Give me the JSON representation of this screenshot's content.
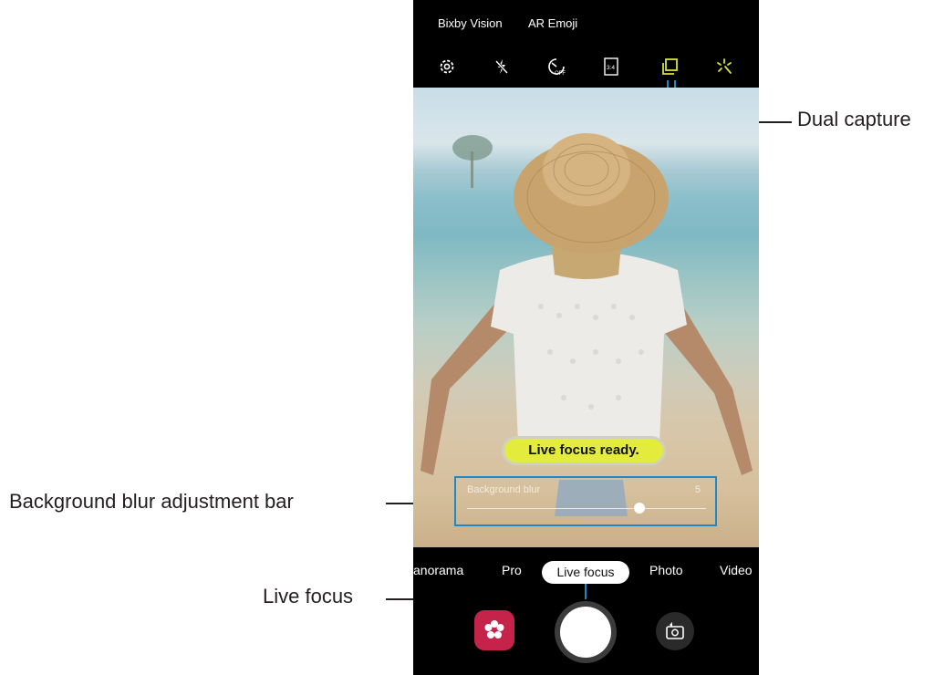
{
  "top_menu": {
    "bixby_vision": "Bixby Vision",
    "ar_emoji": "AR Emoji"
  },
  "quick_settings": {
    "icons": [
      "gear-icon",
      "flash-off-icon",
      "timer-off-icon",
      "aspect-ratio-icon",
      "dual-capture-icon",
      "filter-sparkle-icon"
    ],
    "ratio_label": "3:4",
    "timer_label": "OFF"
  },
  "viewfinder": {
    "status_pill": "Live focus ready.",
    "blur_bar": {
      "label": "Background blur",
      "value": "5",
      "level": 0.72
    }
  },
  "modes": {
    "items": [
      "anorama",
      "Pro",
      "Live focus",
      "Photo",
      "Video"
    ],
    "selected": "Live focus"
  },
  "controls": {
    "left_icon": "bixby-flower-icon",
    "center": "shutter",
    "right_icon": "switch-camera-icon"
  },
  "callouts": {
    "dual_capture": "Dual capture",
    "blur_bar": "Background blur adjustment bar",
    "live_focus": "Live focus"
  },
  "colors": {
    "callout_line": "#1e88c9",
    "pill": "#e3ec3c",
    "bixby": "#c5234a"
  }
}
